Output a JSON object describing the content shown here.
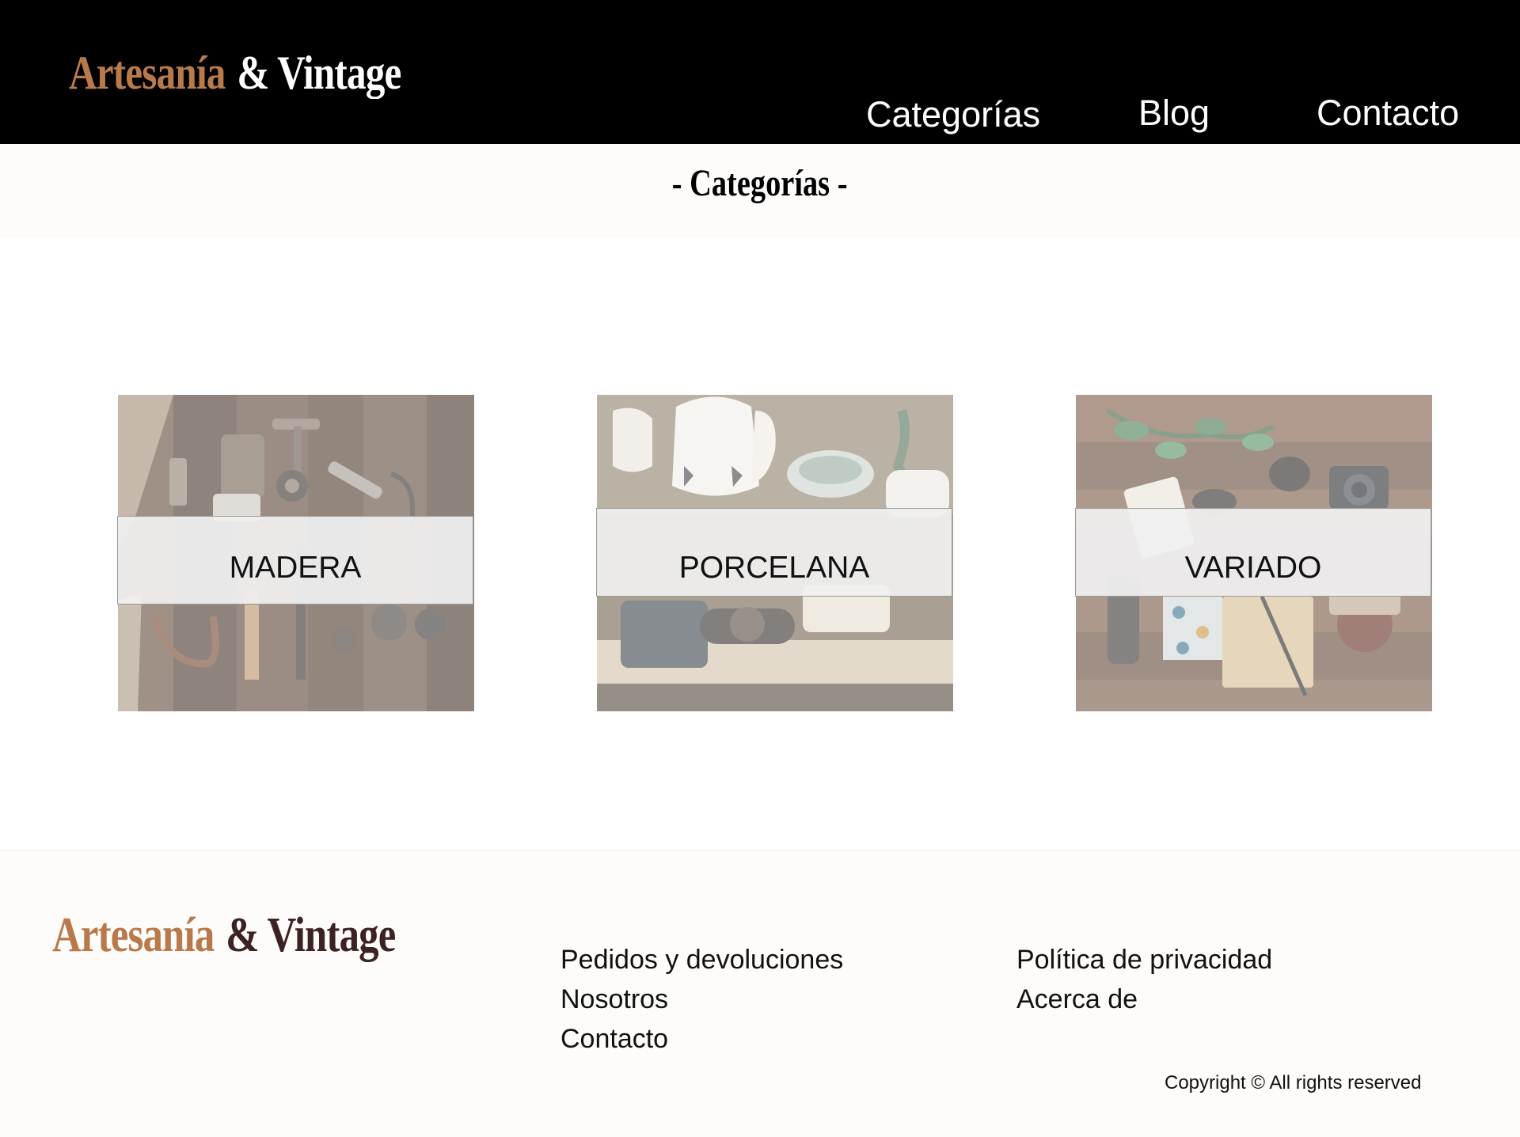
{
  "brand": {
    "word1": "Artesanía",
    "word2": "& Vintage",
    "color_primary": "#b87a4b",
    "color_header_secondary": "#ffffff",
    "color_footer_secondary": "#3d2224"
  },
  "nav": {
    "items": [
      {
        "label": "Categorías"
      },
      {
        "label": "Blog"
      },
      {
        "label": "Contacto"
      }
    ]
  },
  "page": {
    "title": "- Categorías -"
  },
  "categories": [
    {
      "label": "MADERA",
      "image": "wooden-tools-photo"
    },
    {
      "label": "PORCELANA",
      "image": "porcelain-teaware-photo"
    },
    {
      "label": "VARIADO",
      "image": "assorted-vintage-items-photo"
    }
  ],
  "footer": {
    "links_col1": [
      {
        "label": "Pedidos y devoluciones"
      },
      {
        "label": "Nosotros"
      },
      {
        "label": "Contacto"
      }
    ],
    "links_col2": [
      {
        "label": "Política de privacidad"
      },
      {
        "label": "Acerca de"
      }
    ],
    "copyright": "Copyright © All rights reserved"
  },
  "colors": {
    "header_bg": "#000000",
    "band_bg": "#fdfcfa",
    "footer_bg": "#fdfcfa"
  }
}
